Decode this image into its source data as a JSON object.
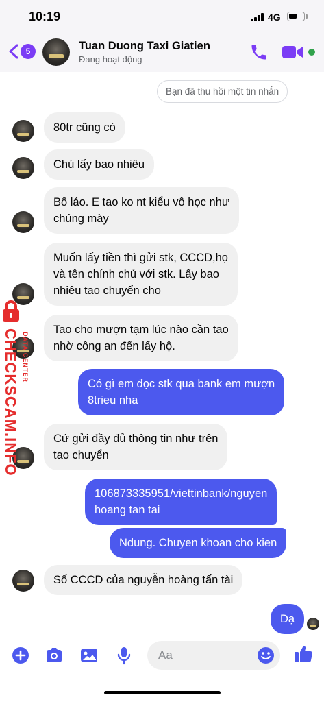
{
  "status_bar": {
    "time": "10:19",
    "network": "4G",
    "battery_level": 0.5
  },
  "header": {
    "back_badge": "5",
    "contact_name": "Tuan Duong Taxi Giatien",
    "contact_status": "Đang hoạt động"
  },
  "system_notice": "Bạn đã thu hồi một tin nhắn",
  "messages": [
    {
      "lines": [
        "80tr cũng có"
      ]
    },
    {
      "lines": [
        "Chú lấy bao nhiêu"
      ]
    },
    {
      "lines": [
        "Bố láo. E tao ko nt kiểu vô học như",
        "chúng mày"
      ]
    },
    {
      "lines": [
        "Muốn lấy tiền thì gửi stk, CCCD,họ",
        "và tên chính chủ với stk. Lấy bao",
        "nhiêu tao chuyển cho"
      ]
    },
    {
      "lines": [
        "Tao cho mượn tạm lúc nào cần tao",
        "nhờ công an đến lấy hộ."
      ]
    },
    {
      "lines": [
        "Có gì em đọc stk qua bank em mượn",
        "8trieu nha"
      ]
    },
    {
      "lines": [
        "Cứ gửi đầy đủ thông tin như trên",
        "tao chuyển"
      ]
    },
    {
      "link": "106873335951",
      "line1_rest": "/viettinbank/nguyen",
      "line2": "hoang tan tai"
    },
    {
      "lines": [
        "Ndung. Chuyen khoan cho kien"
      ]
    },
    {
      "lines": [
        "Số CCCD của nguyễn hoàng tấn tài"
      ]
    },
    {
      "lines": [
        "Dạ"
      ]
    }
  ],
  "watermark": {
    "main": "CHECKSCAM.INFO",
    "sub": "DATA CENTER"
  },
  "composer": {
    "placeholder": "Aa"
  },
  "colors": {
    "accent": "#7b3cf5",
    "outgoing_bubble": "#4c59ee",
    "incoming_bubble": "#f0f0f0",
    "online": "#31a24c",
    "watermark": "#e52d2d"
  },
  "icons": [
    "chevron-left-icon",
    "phone-icon",
    "video-camera-icon",
    "plus-circle-icon",
    "camera-icon",
    "image-icon",
    "microphone-icon",
    "emoji-icon",
    "thumbs-up-icon"
  ]
}
